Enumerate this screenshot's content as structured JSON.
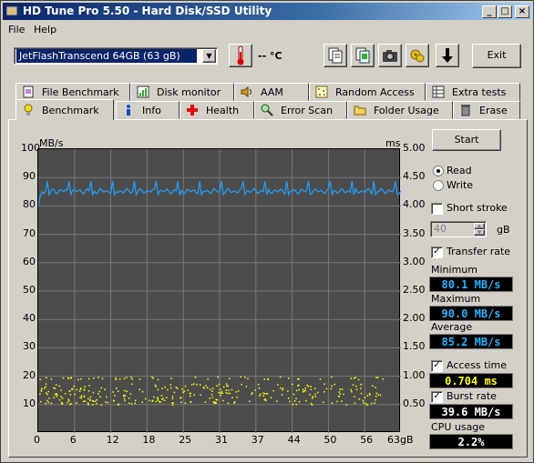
{
  "window": {
    "title": "HD Tune Pro 5.50 - Hard Disk/SSD Utility"
  },
  "menu": [
    "File",
    "Help"
  ],
  "toolbar": {
    "drive": "JetFlashTranscend 64GB (63 gB)",
    "temperature": "-- °C",
    "exit_label": "Exit",
    "tools": [
      "copy-text-icon",
      "copy-info-icon",
      "screenshot-icon",
      "options-icon",
      "download-icon"
    ]
  },
  "tabs_top": [
    "File Benchmark",
    "Disk monitor",
    "AAM",
    "Random Access",
    "Extra tests"
  ],
  "tabs_bottom": [
    "Benchmark",
    "Info",
    "Health",
    "Error Scan",
    "Folder Usage",
    "Erase"
  ],
  "active_tab": "Benchmark",
  "chart_data": {
    "type": "line",
    "title": "",
    "left_axis": {
      "unit": "MB/s",
      "ticks": [
        "100",
        "90",
        "80",
        "70",
        "60",
        "50",
        "40",
        "30",
        "20",
        "10"
      ],
      "ylim": [
        0,
        100
      ]
    },
    "right_axis": {
      "unit": "ms",
      "ticks": [
        "5.00",
        "4.50",
        "4.00",
        "3.50",
        "3.00",
        "2.50",
        "2.00",
        "1.50",
        "1.00",
        "0.50"
      ],
      "ylim": [
        0,
        5
      ]
    },
    "x_axis": {
      "ticks": [
        "0",
        "6",
        "12",
        "18",
        "25",
        "31",
        "37",
        "44",
        "50",
        "56",
        "63gB"
      ],
      "xlim": [
        0,
        63
      ]
    },
    "grid": true,
    "series": [
      {
        "kind": "transfer-rate-line",
        "color": "#1ea0ff",
        "min": 80.1,
        "max": 90.0,
        "average": 85.2,
        "approx_values": [
          80.1,
          85,
          86,
          85,
          85.5,
          86,
          85,
          86,
          85,
          85.5,
          86,
          85,
          85,
          86,
          85
        ]
      },
      {
        "kind": "access-time-scatter",
        "color": "#ffff00",
        "band_ms": [
          0.5,
          1.0
        ],
        "typical_ms": 0.704
      }
    ]
  },
  "controls": {
    "start_label": "Start",
    "read_label": "Read",
    "write_label": "Write",
    "read_selected": true,
    "short_stroke_label": "Short stroke",
    "short_stroke_checked": false,
    "short_stroke_value": "40",
    "short_stroke_unit": "gB",
    "transfer_rate_label": "Transfer rate",
    "transfer_rate_checked": true,
    "access_time_label": "Access time",
    "access_time_checked": true,
    "burst_rate_label": "Burst rate",
    "burst_rate_checked": true
  },
  "stats": {
    "minimum_label": "Minimum",
    "minimum": "80.1 MB/s",
    "maximum_label": "Maximum",
    "maximum": "90.0 MB/s",
    "average_label": "Average",
    "average": "85.2 MB/s",
    "access_time": "0.704 ms",
    "burst_rate": "39.6 MB/s",
    "cpu_label": "CPU usage",
    "cpu": "2.2%"
  },
  "colors": {
    "value_text": "#25b4ff",
    "access_value_text": "#ffff00",
    "graph_bg": "#4c4c4c",
    "grid": "#777777"
  }
}
